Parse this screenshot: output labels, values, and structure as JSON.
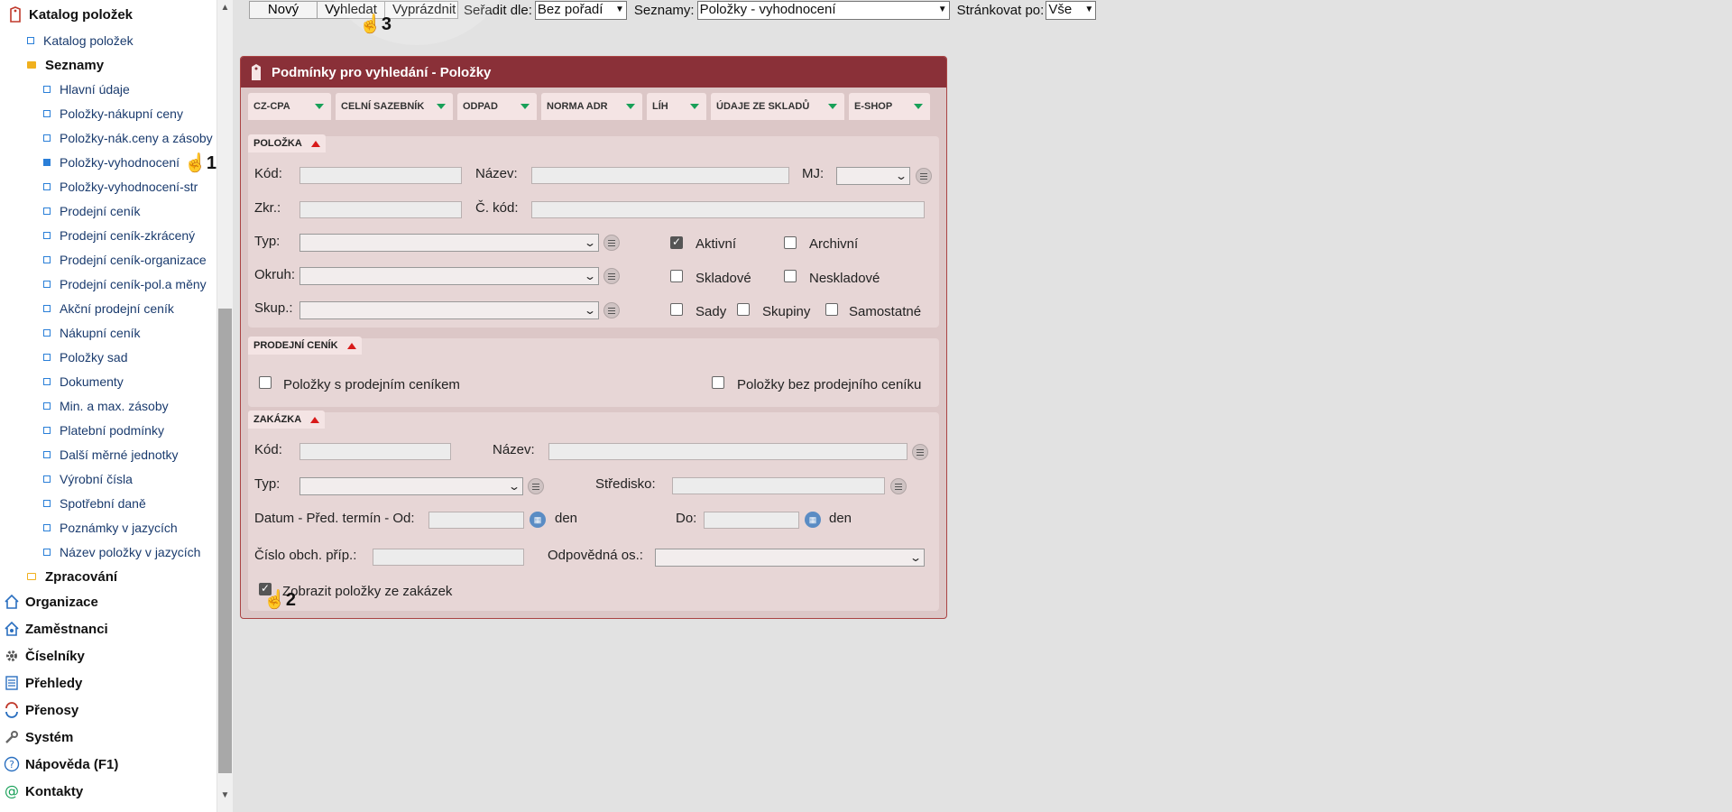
{
  "sidebar": {
    "root": "Katalog položek",
    "items": [
      {
        "label": "Katalog položek",
        "level": 1,
        "kind": "item",
        "selected": false
      },
      {
        "label": "Seznamy",
        "level": 1,
        "kind": "folder",
        "bold": true
      },
      {
        "label": "Hlavní údaje",
        "level": 2,
        "kind": "item"
      },
      {
        "label": "Položky-nákupní ceny",
        "level": 2,
        "kind": "item"
      },
      {
        "label": "Položky-nák.ceny a zásoby",
        "level": 2,
        "kind": "item"
      },
      {
        "label": "Položky-vyhodnocení",
        "level": 2,
        "kind": "item",
        "selected": true
      },
      {
        "label": "Položky-vyhodnocení-str",
        "level": 2,
        "kind": "item"
      },
      {
        "label": "Prodejní ceník",
        "level": 2,
        "kind": "item"
      },
      {
        "label": "Prodejní ceník-zkrácený",
        "level": 2,
        "kind": "item"
      },
      {
        "label": "Prodejní ceník-organizace",
        "level": 2,
        "kind": "item"
      },
      {
        "label": "Prodejní ceník-pol.a měny",
        "level": 2,
        "kind": "item"
      },
      {
        "label": "Akční prodejní ceník",
        "level": 2,
        "kind": "item"
      },
      {
        "label": "Nákupní ceník",
        "level": 2,
        "kind": "item"
      },
      {
        "label": "Položky sad",
        "level": 2,
        "kind": "item"
      },
      {
        "label": "Dokumenty",
        "level": 2,
        "kind": "item"
      },
      {
        "label": "Min. a max. zásoby",
        "level": 2,
        "kind": "item"
      },
      {
        "label": "Platební podmínky",
        "level": 2,
        "kind": "item"
      },
      {
        "label": "Další měrné jednotky",
        "level": 2,
        "kind": "item"
      },
      {
        "label": "Výrobní čísla",
        "level": 2,
        "kind": "item"
      },
      {
        "label": "Spotřební daně",
        "level": 2,
        "kind": "item"
      },
      {
        "label": "Poznámky v jazycích",
        "level": 2,
        "kind": "item"
      },
      {
        "label": "Název položky v jazycích",
        "level": 2,
        "kind": "item"
      },
      {
        "label": "Zpracování",
        "level": 1,
        "kind": "folder-empty",
        "bold": true
      }
    ],
    "modules": [
      {
        "label": "Organizace",
        "icon": "house-icon"
      },
      {
        "label": "Zaměstnanci",
        "icon": "employees-house-icon"
      },
      {
        "label": "Číselníky",
        "icon": "gear-icon"
      },
      {
        "label": "Přehledy",
        "icon": "list-doc-icon"
      },
      {
        "label": "Přenosy",
        "icon": "transfer-icon"
      },
      {
        "label": "Systém",
        "icon": "wrench-icon"
      },
      {
        "label": "Nápověda (F1)",
        "icon": "help-icon"
      },
      {
        "label": "Kontakty",
        "icon": "at-icon"
      }
    ]
  },
  "toolbar": {
    "new_label": "Nový",
    "search_label": "Vyhledat",
    "clear_label": "Vyprázdnit",
    "sort_label": "Seřadit dle:",
    "sort_value": "Bez pořadí",
    "lists_label": "Seznamy:",
    "lists_value": "Položky - vyhodnocení",
    "paging_label": "Stránkovat po:",
    "paging_value": "Vše"
  },
  "panel": {
    "title": "Podmínky pro vyhledání - Položky",
    "tabs": [
      "CZ-CPA",
      "CELNÍ SAZEBNÍK",
      "ODPAD",
      "NORMA ADR",
      "LÍH",
      "ÚDAJE ZE SKLADŮ",
      "E-SHOP"
    ],
    "polozka": {
      "title": "POLOŽKA",
      "kod": "Kód:",
      "nazev": "Název:",
      "mj": "MJ:",
      "zkr": "Zkr.:",
      "ckod": "Č. kód:",
      "typ": "Typ:",
      "okruh": "Okruh:",
      "skup": "Skup.:",
      "aktivni": "Aktivní",
      "archivni": "Archivní",
      "skladove": "Skladové",
      "neskladove": "Neskladové",
      "sady": "Sady",
      "skupiny": "Skupiny",
      "samostatne": "Samostatné"
    },
    "cenik": {
      "title": "PRODEJNÍ CENÍK",
      "with": "Položky s prodejním ceníkem",
      "without": "Položky bez prodejního ceníku"
    },
    "zakazka": {
      "title": "ZAKÁZKA",
      "kod": "Kód:",
      "nazev": "Název:",
      "typ": "Typ:",
      "stredisko": "Středisko:",
      "datum": "Datum - Před. termín - Od:",
      "den1": "den",
      "do": "Do:",
      "den2": "den",
      "cislo": "Číslo obch. příp.:",
      "odpovedna": "Odpovědná os.:",
      "zobrazit": "Zobrazit položky ze zakázek"
    }
  },
  "markers": [
    "1",
    "2",
    "3"
  ],
  "colors": {
    "panel_header": "#8a3038",
    "accent_blue": "#2a7fd8",
    "tab_arrow": "#18a058",
    "section_arrow": "#d81a1a"
  }
}
